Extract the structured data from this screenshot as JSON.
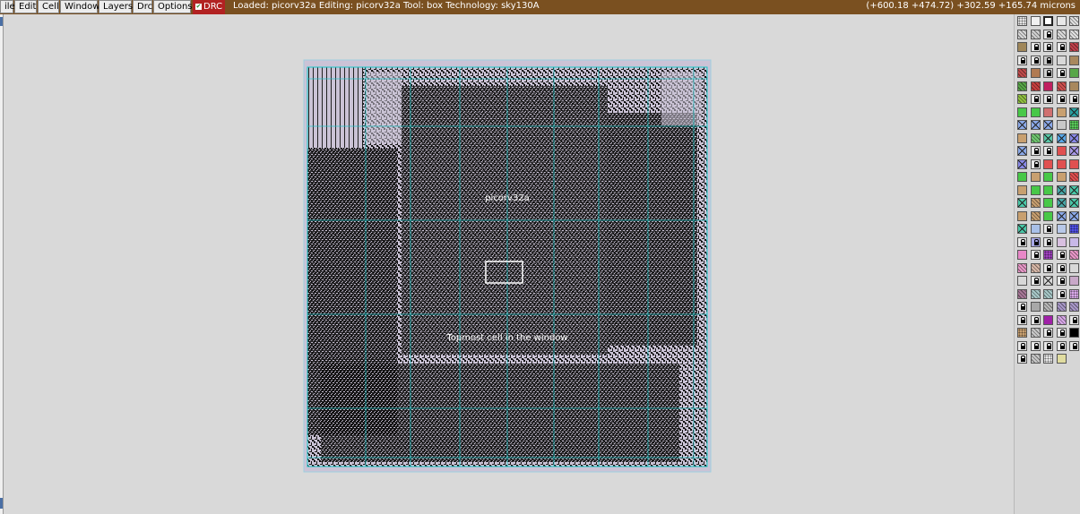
{
  "menubar": {
    "items": [
      {
        "id": "file",
        "label": "ile"
      },
      {
        "id": "edit",
        "label": "Edit"
      },
      {
        "id": "cell",
        "label": "Cell"
      },
      {
        "id": "window",
        "label": "Window"
      },
      {
        "id": "layers",
        "label": "Layers"
      },
      {
        "id": "drc-menu",
        "label": "Drc"
      },
      {
        "id": "options",
        "label": "Options"
      }
    ],
    "drc_toggle": {
      "label": "DRC",
      "checked": true
    },
    "status": "Loaded: picorv32a  Editing: picorv32a  Tool: box  Technology: sky130A",
    "coordinates": "(+600.18 +474.72) +302.59 +165.74 microns"
  },
  "layout": {
    "cell_name": "picorv32a",
    "window_hint": "Topmost cell in the window",
    "colors": {
      "background": "#d9d9d9",
      "cell_fill": "#cbc3d6",
      "grid": "#17c8c8",
      "box": "#ffffff",
      "menubar": "#7a5020"
    }
  },
  "palette": {
    "icons": "layer-swatch-icon",
    "rows": [
      [
        "#e4e4e4|dots",
        "#f0f0f0|",
        "#ffffff|box",
        "#e8e8e8|",
        "#e0e0e0|hatch"
      ],
      [
        "#d8d8d8|hatch",
        "#d0d0d0|hatch",
        "#e8e8e8|lock",
        "#dcdcdc|hatch",
        "#e0e0e0|hatch"
      ],
      [
        "#a0875a|",
        "#e8e8e8|lock",
        "#e8e8e8|lock",
        "#e8e8e8|lock",
        "#c0404a|hatch"
      ],
      [
        "#e8e8e8|lock",
        "#e8e8e8|lock",
        "#c8c8c8|lock",
        "#d8d8d8|",
        "#a8885e|"
      ],
      [
        "#c04a4a|hatch",
        "#b07a52|",
        "#d0d0d0|lock",
        "#e8e8e8|lock",
        "#58a648|"
      ],
      [
        "#58a648|hatch",
        "#c84040|hatch",
        "#c02060|",
        "#d05050|hatch",
        "#a8885e|"
      ],
      [
        "#90c040|hatch",
        "#e8e8e8|lock",
        "#e8e8e8|lock",
        "#e8e8e8|lock",
        "#e8e8e8|lock"
      ],
      [
        "#48c848|",
        "#48c848|",
        "#d07070|",
        "#c8a070|",
        "#28a0a0|cross"
      ],
      [
        "#8aa8e8|cross",
        "#8aa8e8|cross",
        "#8aa8e8|cross",
        "#c8c8c8|",
        "#58c858|dots"
      ],
      [
        "#c8a070|",
        "#70c870|hatch",
        "#58c8a8|cross",
        "#58a8e8|cross",
        "#8888e8|cross"
      ],
      [
        "#8aa8e8|cross",
        "#e8e8e8|lock",
        "#e8e8e8|lock",
        "#e05050|",
        "#a898e8|cross"
      ],
      [
        "#8888e8|cross",
        "#e8e8e8|lock",
        "#e05050|",
        "#e05050|",
        "#e05050|"
      ],
      [
        "#48c848|",
        "#c8a070|",
        "#48c848|",
        "#c8a070|",
        "#e05050|hatch"
      ],
      [
        "#c8a070|",
        "#48c848|",
        "#48c848|",
        "#48a8a8|cross",
        "#48c8a8|cross"
      ],
      [
        "#48c8a8|cross",
        "#c8a070|hatch",
        "#48c848|",
        "#48a8a8|cross",
        "#48c8a8|cross"
      ],
      [
        "#c8a070|",
        "#c8a070|hatch",
        "#48c848|",
        "#8aa8e8|cross",
        "#8aa8e8|cross"
      ],
      [
        "#48c8a8|cross",
        "#a8c0e8|",
        "#e8e8e8|lock",
        "#b8c8e8|",
        "#5050e8|dots"
      ],
      [
        "#e8e8e8|lock",
        "#a8a8e8|lock",
        "#e8e8e8|lock",
        "#d8c0e0|",
        "#c8b8e8|"
      ],
      [
        "#e888c8|",
        "#e8e8e8|lock",
        "#a040c0|dots",
        "#e8e8e8|lock",
        "#e898c8|hatch"
      ],
      [
        "#e898c8|hatch",
        "#d8b8a8|hatch",
        "#e8e8e8|lock",
        "#e8e8e8|lock",
        "#d8d8d8|"
      ],
      [
        "#d8d8d8|",
        "#e8e8e8|lock",
        "#d8d8d8|cross",
        "#e8e8e8|lock",
        "#c8a8c8|"
      ],
      [
        "#a87898|hatch",
        "#a8c8c8|hatch",
        "#a8c8c8|hatch",
        "#e8e8e8|lock",
        "#d8a8e8|dots"
      ],
      [
        "#e8e8e8|lock",
        "#a8a8a8|",
        "#b8b8b8|hatch",
        "#a898c8|hatch",
        "#a898c8|hatch"
      ],
      [
        "#e8e8e8|lock",
        "#e8e8e8|lock",
        "#a020a8|",
        "#d8a8e8|hatch",
        "#e8e8e8|lock"
      ],
      [
        "#c8a070|dots",
        "#c8c8c8|hatch",
        "#e8e8e8|lock",
        "#e8e8e8|lock",
        "#000000|"
      ],
      [
        "#e8e8e8|lock",
        "#e8e8e8|lock",
        "#e8e8e8|lock",
        "#e8e8e8|lock",
        "#e8e8e8|lock"
      ],
      [
        "#e8e8e8|lock",
        "#c8c8c8|hatch",
        "#e8e8e8|dots",
        "#e0dca0|"
      ]
    ]
  }
}
